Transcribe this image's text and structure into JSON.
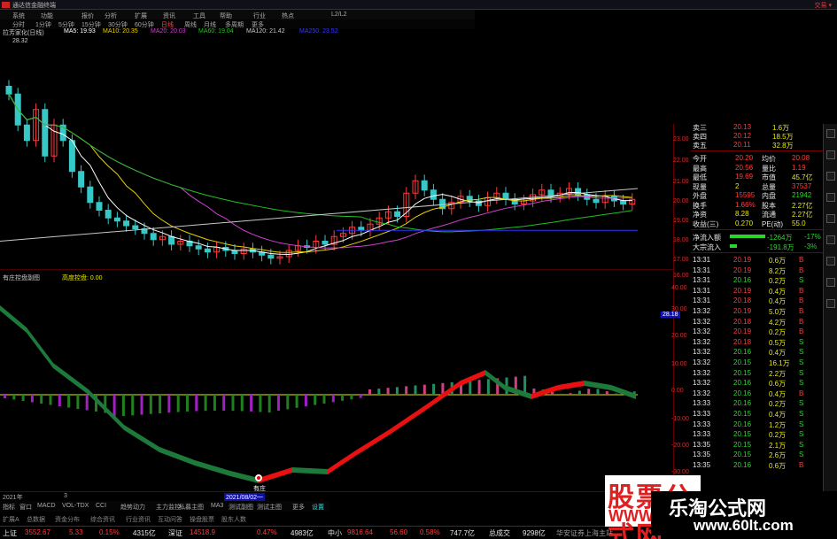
{
  "window": {
    "title": "通达信金融终端",
    "right_text": "交易 ▾"
  },
  "toolbar": {
    "items": [
      "系统",
      "功能",
      "报价",
      "分析",
      "扩展",
      "资讯",
      "工具",
      "帮助",
      "行业",
      "热点",
      "L2/L2"
    ]
  },
  "periods": {
    "items": [
      "分时",
      "1分钟",
      "5分钟",
      "15分钟",
      "30分钟",
      "60分钟",
      "日线",
      "周线",
      "月线",
      "多周期",
      "更多"
    ]
  },
  "ma_bar": {
    "stock": "拉芳家化(日线)",
    "ma5": "MA5: 19.93",
    "ma10": "MA10: 20.35",
    "ma20": "MA20: 20.03",
    "ma60": "MA60: 19.04",
    "ma120": "MA120: 21.42",
    "extra": "MA250: 23.52"
  },
  "chart_labels": {
    "high": "28.32",
    "year_left": "2021年",
    "month_mark": "3",
    "date_cursor": "2021/08/02一",
    "marker": "有庄"
  },
  "indicator": {
    "name": "有庄控盘副图",
    "value_label": "高度控盘: 0.00"
  },
  "colors": {
    "up": "#ff3b3b",
    "down": "#36c7c7",
    "ma5": "#ffffff",
    "ma10": "#e8d000",
    "ma20": "#d040d0",
    "ma60": "#20c020",
    "ma120": "#c8c8c8",
    "ribbon_up": "#e81010",
    "ribbon_down": "#1e7a3a"
  },
  "quote": {
    "rows": [
      {
        "label": "卖三",
        "val": "20.13",
        "vol": "1.6万"
      },
      {
        "label": "卖四",
        "val": "20.12",
        "vol": "18.5万"
      },
      {
        "label": "卖五",
        "val": "20.11",
        "vol": "32.8万"
      }
    ],
    "stats": [
      {
        "l1": "今开",
        "v1": "20.20",
        "l2": "均价",
        "v2": "20.08"
      },
      {
        "l1": "最高",
        "v1": "20.56",
        "l2": "量比",
        "v2": "1.19"
      },
      {
        "l1": "最低",
        "v1": "19.69",
        "l2": "市值",
        "v2": "45.7亿"
      },
      {
        "l1": "现量",
        "v1": "2",
        "l2": "总量",
        "v2": "37537"
      },
      {
        "l1": "外盘",
        "v1": "15595",
        "l2": "内盘",
        "v2": "21942"
      },
      {
        "l1": "换手",
        "v1": "1.66%",
        "l2": "股本",
        "v2": "2.27亿"
      },
      {
        "l1": "净资",
        "v1": "8.28",
        "l2": "流通",
        "v2": "2.27亿"
      },
      {
        "l1": "收益(三)",
        "v1": "0.270",
        "l2": "PE(动)",
        "v2": "55.0"
      }
    ],
    "netflow": {
      "label": "净流入额",
      "value": "-1264万",
      "pct": "-17%"
    },
    "bigflow": {
      "label": "大宗流入",
      "value": "-191.8万",
      "pct": "-3%"
    }
  },
  "ticks": [
    {
      "t": "13:31",
      "p": "20.19",
      "v": "0.6万",
      "s": "B"
    },
    {
      "t": "13:31",
      "p": "20.19",
      "v": "8.2万",
      "s": "B"
    },
    {
      "t": "13:31",
      "p": "20.16",
      "v": "0.2万",
      "s": "S"
    },
    {
      "t": "13:31",
      "p": "20.19",
      "v": "0.4万",
      "s": "B"
    },
    {
      "t": "13:31",
      "p": "20.18",
      "v": "0.4万",
      "s": "B"
    },
    {
      "t": "13:32",
      "p": "20.19",
      "v": "5.0万",
      "s": "B"
    },
    {
      "t": "13:32",
      "p": "20.18",
      "v": "4.2万",
      "s": "B"
    },
    {
      "t": "13:32",
      "p": "20.19",
      "v": "0.2万",
      "s": "B"
    },
    {
      "t": "13:32",
      "p": "20.18",
      "v": "0.5万",
      "s": "S"
    },
    {
      "t": "13:32",
      "p": "20.16",
      "v": "0.4万",
      "s": "S"
    },
    {
      "t": "13:32",
      "p": "20.15",
      "v": "16.1万",
      "s": "S"
    },
    {
      "t": "13:32",
      "p": "20.15",
      "v": "2.2万",
      "s": "S"
    },
    {
      "t": "13:32",
      "p": "20.16",
      "v": "0.6万",
      "s": "S"
    },
    {
      "t": "13:32",
      "p": "20.16",
      "v": "0.4万",
      "s": "B"
    },
    {
      "t": "13:33",
      "p": "20.16",
      "v": "0.2万",
      "s": "S"
    },
    {
      "t": "13:33",
      "p": "20.15",
      "v": "0.4万",
      "s": "S"
    },
    {
      "t": "13:33",
      "p": "20.16",
      "v": "1.2万",
      "s": "S"
    },
    {
      "t": "13:33",
      "p": "20.15",
      "v": "0.2万",
      "s": "S"
    },
    {
      "t": "13:35",
      "p": "20.15",
      "v": "2.1万",
      "s": "S"
    },
    {
      "t": "13:35",
      "p": "20.15",
      "v": "2.6万",
      "s": "S"
    },
    {
      "t": "13:35",
      "p": "20.16",
      "v": "0.6万",
      "s": "B"
    }
  ],
  "axis_price": [
    "23.00",
    "22.00",
    "21.00",
    "20.00",
    "19.00",
    "18.00",
    "17.00",
    "16.00"
  ],
  "axis_ind": [
    "40.00",
    "30.00",
    "20.00",
    "10.00",
    "0.00",
    "-10.00",
    "-20.00",
    "-30.00",
    "-40.00"
  ],
  "axis_tag": "28.18",
  "sub_tabs": [
    "指标",
    "窗口",
    "MACD",
    "VOL-TDX",
    "CCI",
    "趋势动力",
    "主力监控",
    "私募主图",
    "MA3",
    "测试副图",
    "测试主图",
    "更多",
    "设置"
  ],
  "left_tabs": [
    "扩展A",
    "总数据",
    "资金分布",
    "综合资讯",
    "行业资讯",
    "互动问答",
    "操盘股票",
    "股东人数"
  ],
  "status": {
    "sh_label": "上证",
    "sh": "3552.67",
    "sh_chg": "5.33",
    "sh_pct": "0.15%",
    "sh_amt": "4315亿",
    "sz_label": "深证",
    "sz": "14518.9",
    "sz_pct": "0.47%",
    "sz_amt": "4983亿",
    "zx_label": "中小",
    "zx": "9816.64",
    "zx_chg": "56.60",
    "zx_pct": "0.58%",
    "zx_amt": "747.7亿",
    "total_label": "总成交",
    "total": "9298亿",
    "broker": "华安证券上海主站"
  },
  "watermark": {
    "line1": "股票公式网",
    "line2": "WWW.",
    "site_cn": "乐淘公式网",
    "site_url": "www.60lt.com"
  }
}
